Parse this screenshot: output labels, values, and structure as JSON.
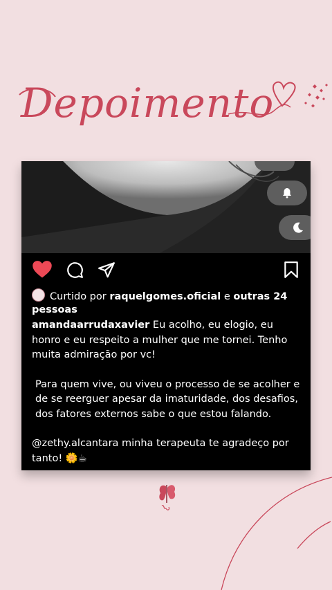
{
  "header": {
    "title": "Depoimento"
  },
  "post": {
    "liked_prefix": "Curtido por",
    "liked_user": "raquelgomes.oficial",
    "liked_and": "e",
    "liked_others": "outras 24",
    "liked_people": "pessoas",
    "author": "amandaarrudaxavier",
    "caption_line1": "Eu acolho, eu elogio, eu honro e eu respeito a mulher que me tornei. Tenho muita admiração por vc!",
    "caption_para2": "Para quem vive, ou viveu o processo de se acolher e de se reerguer apesar da imaturidade, dos desafios, dos fatores externos sabe o que estou falando.",
    "caption_para3": "@zethy.alcantara minha terapeuta te agradeço por tanto! 🌼☕",
    "liked": true
  },
  "colors": {
    "background": "#f2dfe1",
    "accent": "#c9485b",
    "like": "#ed4956"
  },
  "icons": [
    "heart-icon",
    "comment-icon",
    "share-icon",
    "bookmark-icon",
    "bell-icon",
    "moon-icon",
    "butterfly-icon"
  ]
}
